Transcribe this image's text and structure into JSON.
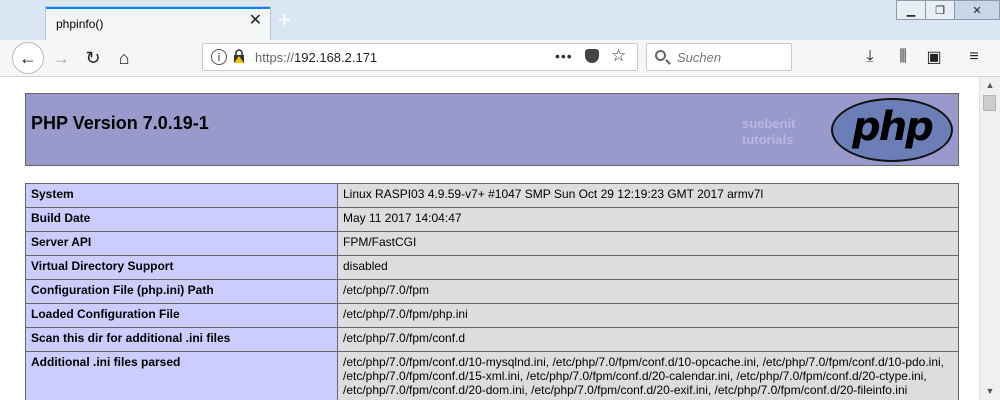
{
  "browser": {
    "tab_title": "phpinfo()",
    "url_protocol": "https://",
    "url_host": "192.168.2.171",
    "search_placeholder": "Suchen",
    "accent_color": "#0a84ff"
  },
  "page": {
    "title": "PHP Version 7.0.19-1",
    "watermark_line1": "suebenit",
    "watermark_line2": "tutorials",
    "logo_text": "php",
    "colors": {
      "header_bg": "#9999cc",
      "label_bg": "#ccccff",
      "value_bg": "#dddddd"
    }
  },
  "info_rows": [
    {
      "label": "System",
      "value": "Linux RASPI03 4.9.59-v7+ #1047 SMP Sun Oct 29 12:19:23 GMT 2017 armv7l"
    },
    {
      "label": "Build Date",
      "value": "May 11 2017 14:04:47"
    },
    {
      "label": "Server API",
      "value": "FPM/FastCGI"
    },
    {
      "label": "Virtual Directory Support",
      "value": "disabled"
    },
    {
      "label": "Configuration File (php.ini) Path",
      "value": "/etc/php/7.0/fpm"
    },
    {
      "label": "Loaded Configuration File",
      "value": "/etc/php/7.0/fpm/php.ini"
    },
    {
      "label": "Scan this dir for additional .ini files",
      "value": "/etc/php/7.0/fpm/conf.d"
    },
    {
      "label": "Additional .ini files parsed",
      "value": "/etc/php/7.0/fpm/conf.d/10-mysqlnd.ini, /etc/php/7.0/fpm/conf.d/10-opcache.ini, /etc/php/7.0/fpm/conf.d/10-pdo.ini, /etc/php/7.0/fpm/conf.d/15-xml.ini, /etc/php/7.0/fpm/conf.d/20-calendar.ini, /etc/php/7.0/fpm/conf.d/20-ctype.ini, /etc/php/7.0/fpm/conf.d/20-dom.ini, /etc/php/7.0/fpm/conf.d/20-exif.ini, /etc/php/7.0/fpm/conf.d/20-fileinfo.ini"
    }
  ]
}
